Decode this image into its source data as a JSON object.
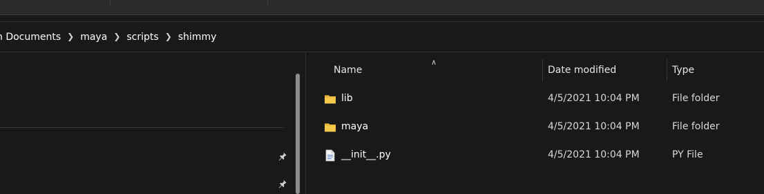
{
  "breadcrumb": [
    "n Documents",
    "maya",
    "scripts",
    "shimmy"
  ],
  "columns": {
    "name": "Name",
    "date_modified": "Date modified",
    "type": "Type"
  },
  "files": [
    {
      "name": "lib",
      "date_modified": "4/5/2021 10:04 PM",
      "type": "File folder",
      "icon": "folder-icon"
    },
    {
      "name": "maya",
      "date_modified": "4/5/2021 10:04 PM",
      "type": "File folder",
      "icon": "folder-icon"
    },
    {
      "name": "__init__.py",
      "date_modified": "4/5/2021 10:04 PM",
      "type": "PY File",
      "icon": "file-icon"
    }
  ],
  "theme": {
    "background": "#191919",
    "folder_color": "#f5c94c",
    "text": "#ffffff"
  }
}
